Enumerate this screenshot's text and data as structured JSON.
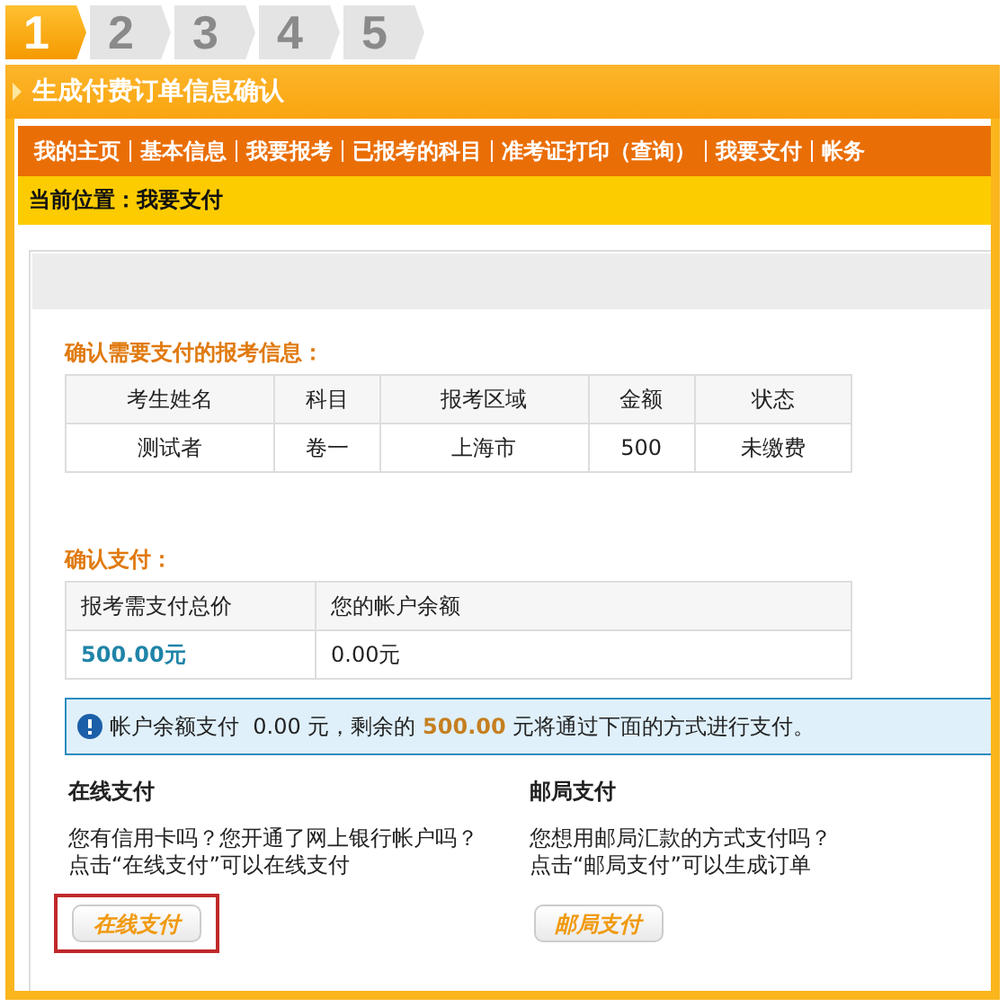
{
  "steps": [
    {
      "label": "1",
      "selected": true
    },
    {
      "label": "2",
      "selected": false
    },
    {
      "label": "3",
      "selected": false
    },
    {
      "label": "4",
      "selected": false
    },
    {
      "label": "5",
      "selected": false
    }
  ],
  "panel_title": "生成付费订单信息确认",
  "nav": [
    "我的主页",
    "基本信息",
    "我要报考",
    "已报考的科目",
    "准考证打印（查询）",
    "我要支付",
    "帐务"
  ],
  "breadcrumb": "当前位置：我要支付",
  "exam_section": {
    "title": "确认需要支付的报考信息：",
    "columns": [
      "考生姓名",
      "科目",
      "报考区域",
      "金额",
      "状态"
    ],
    "rows": [
      [
        "测试者",
        "卷一",
        "上海市",
        "500",
        "未缴费"
      ]
    ]
  },
  "payment_section": {
    "title": "确认支付：",
    "columns": [
      "报考需支付总价",
      "您的帐户余额"
    ],
    "total": "500.00元",
    "balance": "0.00元"
  },
  "notice": {
    "text_before": "帐户余额支付",
    "paid": "0.00",
    "unit1": "元，剩余的",
    "remaining": "500.00",
    "text_after": "元将通过下面的方式进行支付。"
  },
  "methods": [
    {
      "title": "在线支付",
      "lines": [
        "您有信用卡吗？您开通了网上银行帐户吗？",
        "点击“在线支付”可以在线支付"
      ],
      "button": "在线支付",
      "highlighted": true
    },
    {
      "title": "邮局支付",
      "lines": [
        "您想用邮局汇款的方式支付吗？",
        "点击“邮局支付”可以生成订单"
      ],
      "button": "邮局支付",
      "highlighted": false
    }
  ]
}
